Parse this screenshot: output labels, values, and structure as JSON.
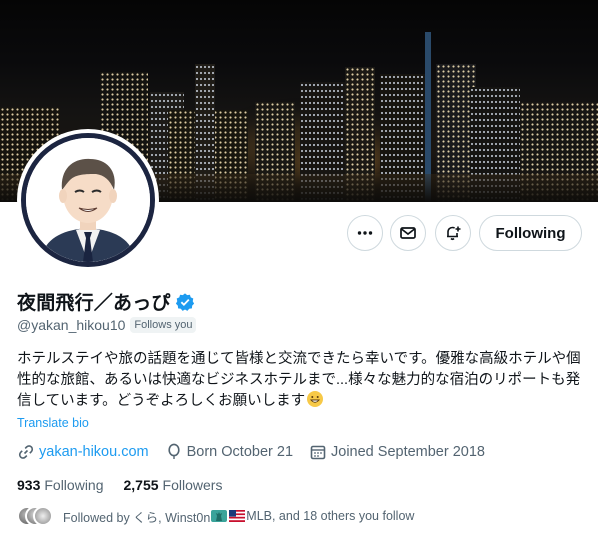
{
  "profile": {
    "display_name": "夜間飛行／あっぴ",
    "handle": "@yakan_hikou10",
    "follows_you": "Follows you",
    "bio": "ホテルステイや旅の話題を通じて皆様と交流できたら幸いです。優雅な高級ホテルや個性的な旅館、あるいは快適なビジネスホテルまで...様々な魅力的な宿泊のリポートも発信しています。どうぞよろしくお願いします",
    "translate_label": "Translate bio",
    "website": "yakan-hikou.com",
    "born": "Born October 21",
    "joined": "Joined September 2018",
    "following_count": "933",
    "following_label": "Following",
    "followers_count": "2,755",
    "followers_label": "Followers",
    "followed_by_prefix": "Followed by くら, Winst0n",
    "followed_by_suffix": "MLB, and 18 others you follow"
  },
  "actions": {
    "more_icon": "more-horizontal-icon",
    "message_icon": "envelope-icon",
    "notify_icon": "bell-plus-icon",
    "follow_label": "Following"
  },
  "colors": {
    "accent": "#1d9bf0",
    "text_primary": "#0f1419",
    "text_secondary": "#536471",
    "border": "#cfd9de",
    "avatar_ring": "#1c2541"
  }
}
